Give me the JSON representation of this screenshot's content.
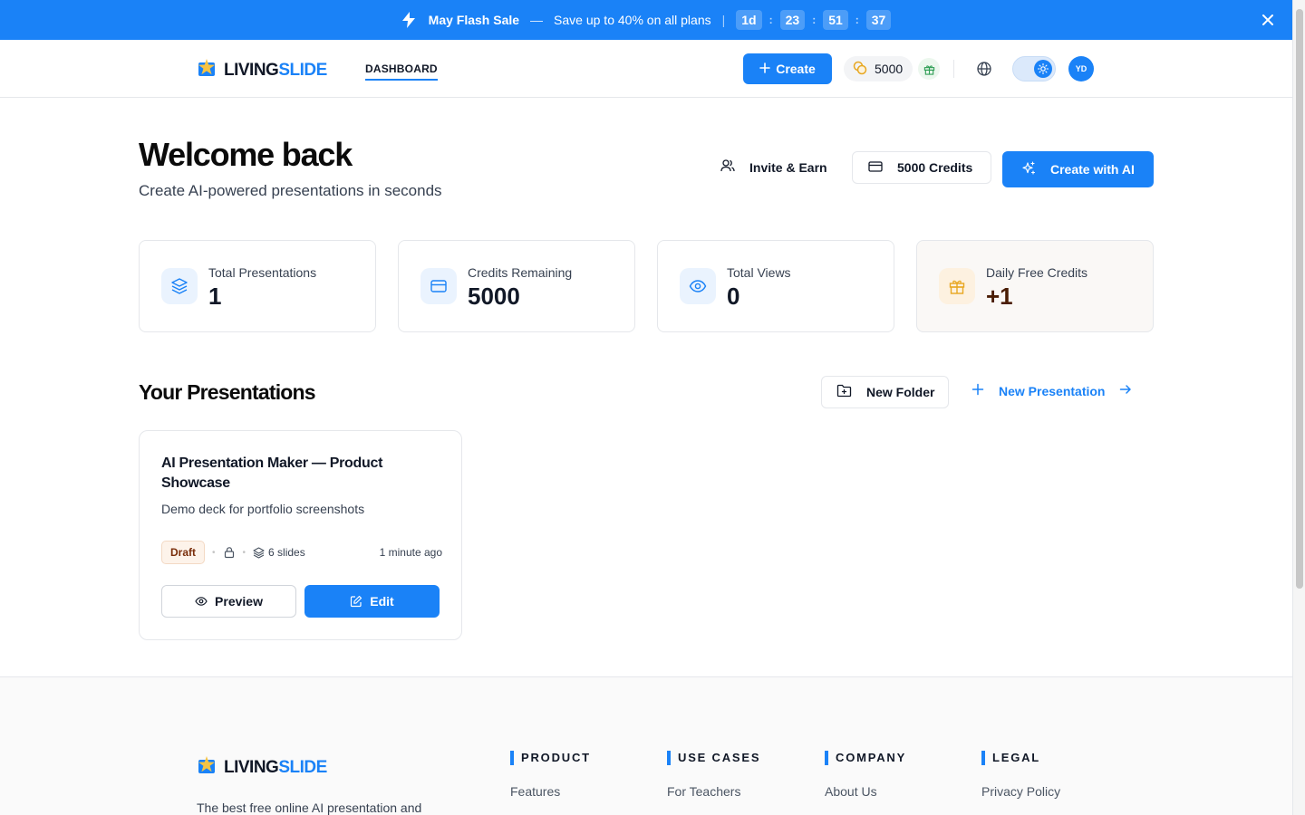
{
  "promo": {
    "title": "May Flash Sale",
    "dash": "—",
    "message": "Save up to 40% on all plans",
    "separator": "|",
    "timer": [
      "1d",
      "23",
      "51",
      "37"
    ],
    "timer_sep": ":"
  },
  "brand": {
    "part1": "LIVING",
    "part2": "SLIDE"
  },
  "header": {
    "nav_dashboard": "DASHBOARD",
    "create_label": "Create",
    "credits": "5000",
    "avatar_initials": "YD"
  },
  "welcome": {
    "title": "Welcome back",
    "subtitle": "Create AI-powered presentations in seconds",
    "invite_label": "Invite & Earn",
    "credits_label": "5000 Credits",
    "create_ai_label": "Create with AI"
  },
  "stats": [
    {
      "label": "Total Presentations",
      "value": "1"
    },
    {
      "label": "Credits Remaining",
      "value": "5000"
    },
    {
      "label": "Total Views",
      "value": "0"
    },
    {
      "label": "Daily Free Credits",
      "value": "+1"
    }
  ],
  "presentations": {
    "title": "Your Presentations",
    "new_folder_label": "New Folder",
    "new_presentation_label": "New Presentation",
    "items": [
      {
        "title": "AI Presentation Maker — Product Showcase",
        "description": "Demo deck for portfolio screenshots",
        "status": "Draft",
        "slides": "6 slides",
        "updated": "1 minute ago",
        "preview_label": "Preview",
        "edit_label": "Edit"
      }
    ]
  },
  "footer": {
    "description": "The best free online AI presentation and",
    "columns": [
      {
        "heading": "PRODUCT",
        "first_link": "Features"
      },
      {
        "heading": "USE CASES",
        "first_link": "For Teachers"
      },
      {
        "heading": "COMPANY",
        "first_link": "About Us"
      },
      {
        "heading": "LEGAL",
        "first_link": "Privacy Policy"
      }
    ]
  },
  "colors": {
    "accent": "#1a82f7",
    "draft_badge_text": "#7a2e0b",
    "daily_credits_value": "#4a1d05"
  }
}
